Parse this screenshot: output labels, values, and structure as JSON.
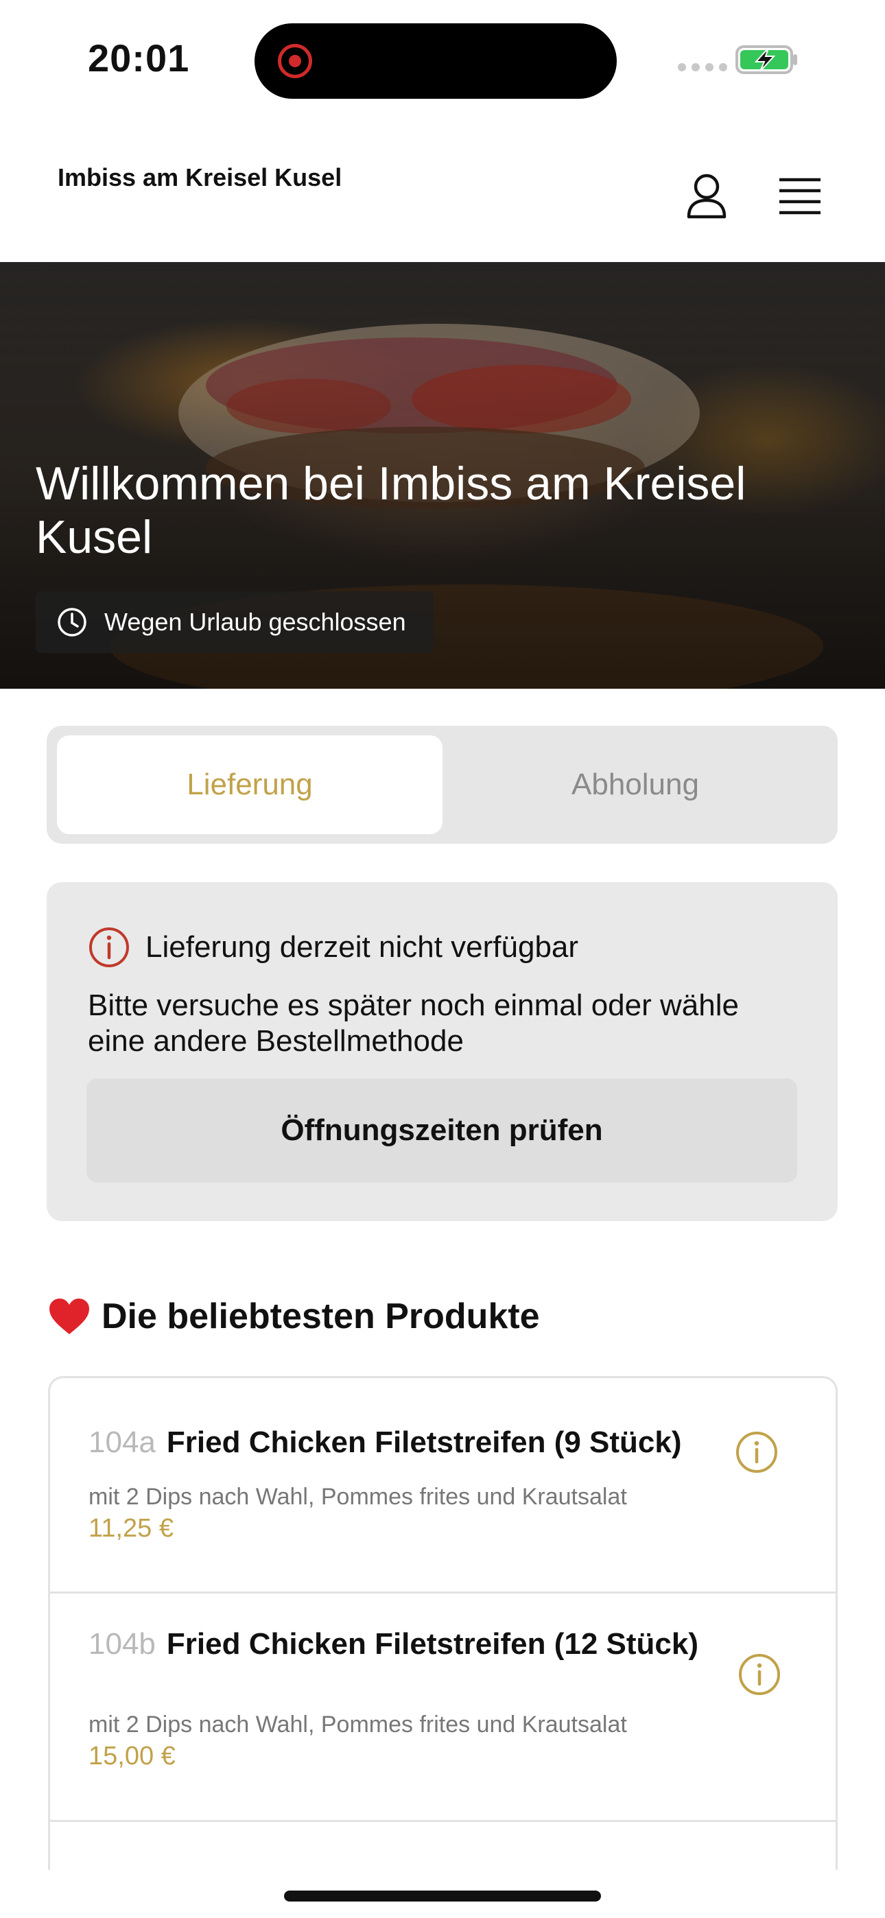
{
  "status_bar": {
    "time": "20:01"
  },
  "header": {
    "restaurant_name": "Imbiss am Kreisel Kusel",
    "account_icon": "person-icon",
    "menu_icon": "hamburger-menu-icon"
  },
  "hero": {
    "title": "Willkommen bei Imbiss am Kreisel Kusel",
    "status": "Wegen Urlaub geschlossen",
    "status_icon": "clock-icon"
  },
  "order_method": {
    "tabs": [
      {
        "label": "Lieferung",
        "active": true
      },
      {
        "label": "Abholung",
        "active": false
      }
    ]
  },
  "notice": {
    "icon": "info-circle-icon",
    "title": "Lieferung derzeit nicht verfügbar",
    "text": "Bitte versuche es später noch einmal oder wähle eine andere Bestellmethode",
    "button_label": "Öffnungszeiten prüfen"
  },
  "popular": {
    "emoji": "heart-icon",
    "title": "Die beliebtesten Produkte",
    "products": [
      {
        "number": "104a",
        "name": "Fried Chicken Filetstreifen (9 Stück)",
        "description": "mit 2 Dips nach Wahl, Pommes frites und Krautsalat",
        "price": "11,25 €"
      },
      {
        "number": "104b",
        "name": "Fried Chicken Filetstreifen (12 Stück)",
        "description": "mit 2 Dips nach Wahl, Pommes frites und Krautsalat",
        "price": "15,00 €"
      }
    ]
  },
  "colors": {
    "accent": "#c1a24a",
    "warning": "#c0392b",
    "heart": "#e0232b"
  }
}
